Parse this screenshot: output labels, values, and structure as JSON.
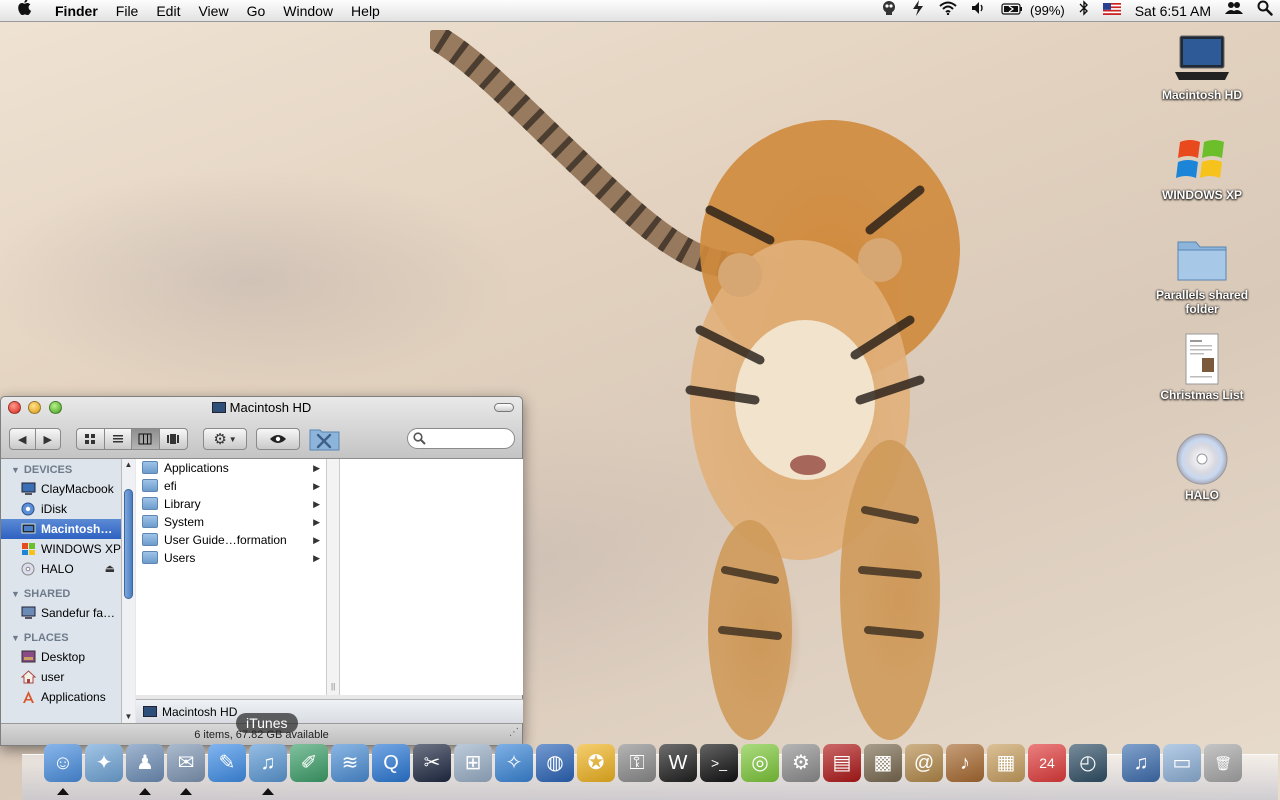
{
  "menubar": {
    "apple_icon": "apple-logo",
    "app_name": "Finder",
    "menus": [
      "File",
      "Edit",
      "View",
      "Go",
      "Window",
      "Help"
    ],
    "battery": "(99%)",
    "clock": "Sat 6:51 AM",
    "status_icons": [
      "crash-reporter-icon",
      "growl-icon",
      "wifi-icon",
      "volume-icon",
      "battery-icon",
      "bluetooth-icon",
      "us-flag-icon",
      "user-switch-icon",
      "spotlight-icon"
    ]
  },
  "desktop": {
    "icons": [
      {
        "label": "Macintosh HD",
        "icon": "laptop-drive-icon"
      },
      {
        "label": "WINDOWS XP",
        "icon": "windows-logo-icon"
      },
      {
        "label": "Parallels shared folder",
        "icon": "folder-icon"
      },
      {
        "label": "Christmas List",
        "icon": "document-icon"
      },
      {
        "label": "HALO",
        "icon": "cd-disc-icon"
      }
    ]
  },
  "finder": {
    "title": "Macintosh HD",
    "sidebar": {
      "devices_header": "DEVICES",
      "devices": [
        {
          "label": "ClayMacbook",
          "icon": "computer-icon"
        },
        {
          "label": "iDisk",
          "icon": "idisk-icon"
        },
        {
          "label": "Macintosh…",
          "icon": "hard-drive-icon",
          "selected": true
        },
        {
          "label": "WINDOWS XP",
          "icon": "windows-logo-icon"
        },
        {
          "label": "HALO",
          "icon": "cd-disc-icon"
        }
      ],
      "shared_header": "SHARED",
      "shared": [
        {
          "label": "Sandefur fa…",
          "icon": "network-computer-icon"
        }
      ],
      "places_header": "PLACES",
      "places": [
        {
          "label": "Desktop",
          "icon": "desktop-icon"
        },
        {
          "label": "user",
          "icon": "home-icon"
        },
        {
          "label": "Applications",
          "icon": "applications-icon"
        }
      ]
    },
    "items": [
      {
        "name": "Applications"
      },
      {
        "name": "efi"
      },
      {
        "name": "Library"
      },
      {
        "name": "System"
      },
      {
        "name": "User Guide…formation"
      },
      {
        "name": "Users"
      }
    ],
    "path_bar": "Macintosh HD",
    "status": "6 items, 67.82 GB available"
  },
  "dock": {
    "tooltip": "iTunes",
    "apps": [
      {
        "name": "finder",
        "color": "#4a8fe0",
        "glyph": "☺",
        "running": true
      },
      {
        "name": "safari",
        "color": "#6fa5d8",
        "glyph": "✦",
        "running": false
      },
      {
        "name": "adium",
        "color": "#6e8fb8",
        "glyph": "♟",
        "running": true
      },
      {
        "name": "mail",
        "color": "#7f97b5",
        "glyph": "✉",
        "running": true
      },
      {
        "name": "ichat",
        "color": "#3f8ee8",
        "glyph": "✎",
        "running": false
      },
      {
        "name": "itunes",
        "color": "#5c9ad6",
        "glyph": "♫",
        "running": true
      },
      {
        "name": "feather",
        "color": "#3da06a",
        "glyph": "✐",
        "running": false
      },
      {
        "name": "network",
        "color": "#4c8fd6",
        "glyph": "≋",
        "running": false
      },
      {
        "name": "quicktime",
        "color": "#2a78d6",
        "glyph": "Q",
        "running": false
      },
      {
        "name": "final-cut",
        "color": "#202a44",
        "glyph": "✂",
        "running": false
      },
      {
        "name": "preview",
        "color": "#9ab0c8",
        "glyph": "⊞",
        "running": false
      },
      {
        "name": "network-utility",
        "color": "#3a86d8",
        "glyph": "✧",
        "running": false
      },
      {
        "name": "google-earth",
        "color": "#2a64b8",
        "glyph": "◍",
        "running": false
      },
      {
        "name": "aim",
        "color": "#f0b420",
        "glyph": "✪",
        "running": false
      },
      {
        "name": "keychain",
        "color": "#8c8c8c",
        "glyph": "⚿",
        "running": false
      },
      {
        "name": "activity-monitor",
        "color": "#202020",
        "glyph": "W",
        "running": false
      },
      {
        "name": "terminal",
        "color": "#111111",
        "glyph": ">_",
        "running": false
      },
      {
        "name": "limewire",
        "color": "#7ec93a",
        "glyph": "◎",
        "running": false
      },
      {
        "name": "system-preferences",
        "color": "#8e8e8e",
        "glyph": "⚙",
        "running": false
      },
      {
        "name": "front-row",
        "color": "#b01818",
        "glyph": "▤",
        "running": false
      },
      {
        "name": "iphoto",
        "color": "#7a6a50",
        "glyph": "▩",
        "running": false
      },
      {
        "name": "address-book",
        "color": "#b48a4a",
        "glyph": "@",
        "running": false
      },
      {
        "name": "garageband",
        "color": "#a86a30",
        "glyph": "♪",
        "running": false
      },
      {
        "name": "iweb",
        "color": "#c9a060",
        "glyph": "▦",
        "running": false
      },
      {
        "name": "ical",
        "color": "#e23b3b",
        "glyph": "24",
        "running": false
      },
      {
        "name": "time-machine",
        "color": "#2f4f66",
        "glyph": "◴",
        "running": false
      },
      {
        "name": "downloads-stack",
        "color": "#3e6fb0",
        "glyph": "♫",
        "running": false
      },
      {
        "name": "documents-stack",
        "color": "#8fb2d9",
        "glyph": "▭",
        "running": false
      },
      {
        "name": "trash",
        "color": "#a7a7a7",
        "glyph": "🗑",
        "running": false
      }
    ]
  }
}
